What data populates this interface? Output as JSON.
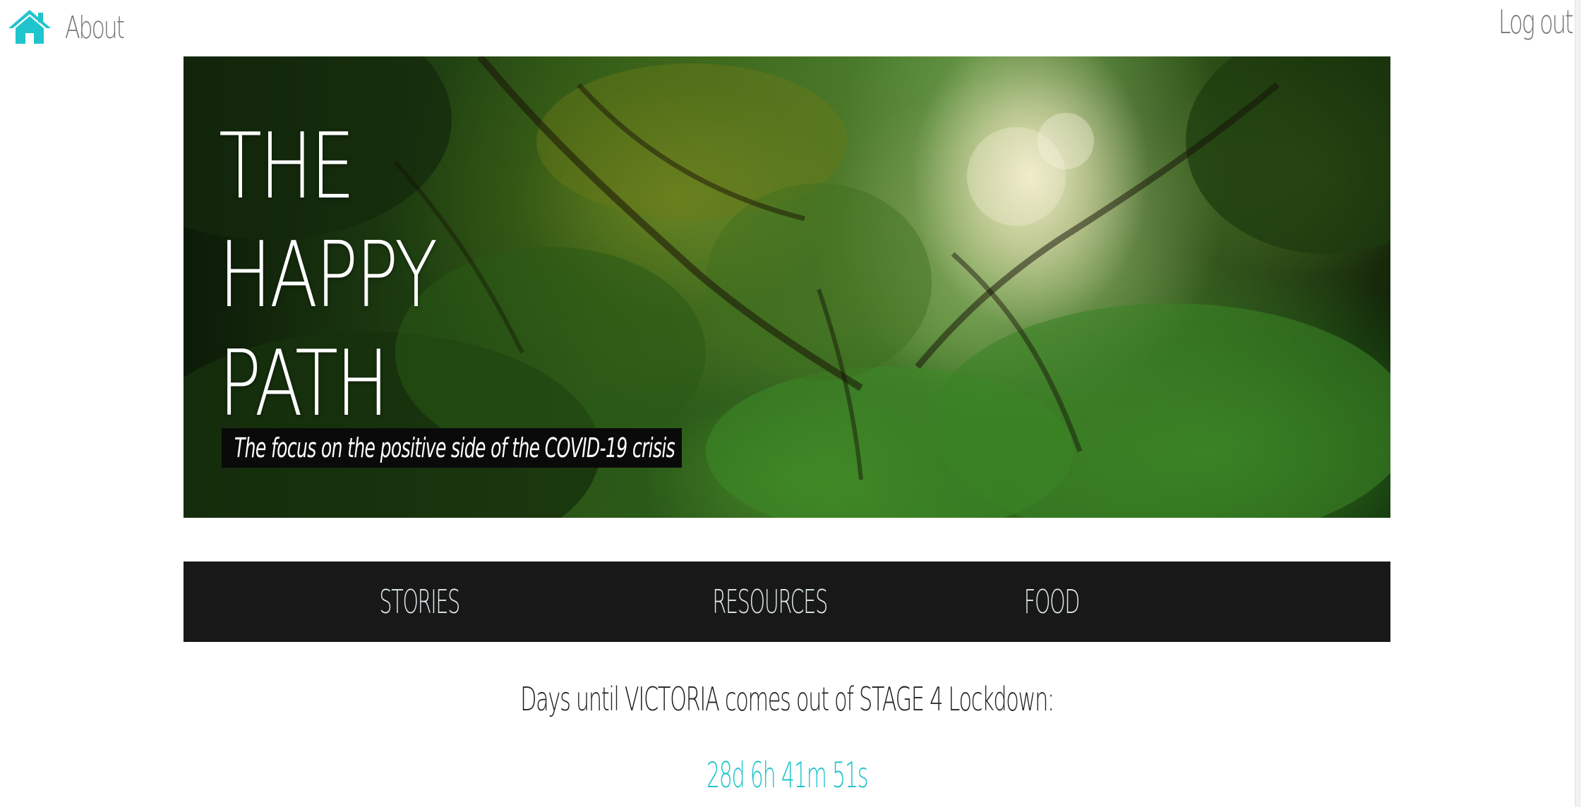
{
  "topbar": {
    "home_icon": "home-icon",
    "about_label": "About",
    "logout_label": "Log out"
  },
  "hero": {
    "title_lines": [
      "THE",
      "HAPPY",
      "PATH"
    ],
    "tagline": "The focus on the positive side of the COVID-19 crisis"
  },
  "nav": {
    "stories_label": "STORIES",
    "resources_label": "RESOURCES",
    "food_label": "FOOD"
  },
  "countdown": {
    "label": "Days until VICTORIA comes out of STAGE 4 Lockdown:",
    "value": "28d 6h 41m 51s"
  },
  "colors": {
    "accent": "#20c4cc",
    "nav_background": "#181818",
    "link_gray": "#777777"
  }
}
